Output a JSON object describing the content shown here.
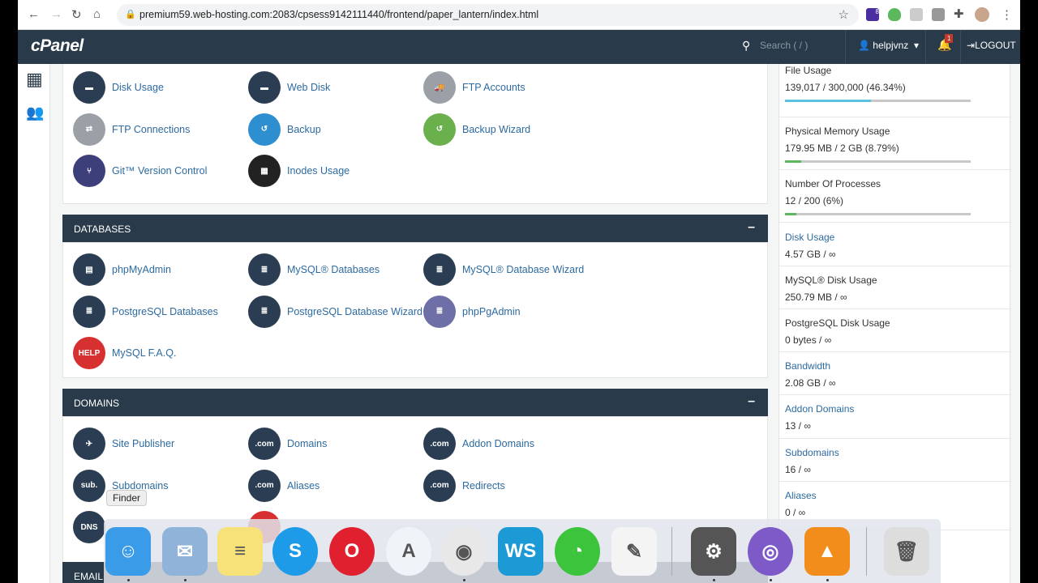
{
  "browser": {
    "url": "premium59.web-hosting.com:2083/cpsess9142111440/frontend/paper_lantern/index.html",
    "extension_badge": "8"
  },
  "header": {
    "logo": "cPanel",
    "search_placeholder": "Search ( / )",
    "user": "helpjvnz",
    "notifications": "1",
    "logout": "LOGOUT"
  },
  "files_items": [
    {
      "label": "Disk Usage",
      "color": "#2b3d52",
      "sub": "#6aa84f",
      "glyph": "▬"
    },
    {
      "label": "Web Disk",
      "color": "#2b3d52",
      "sub": "#3f8f3f",
      "glyph": "▬"
    },
    {
      "label": "FTP Accounts",
      "color": "#9aa0a6",
      "glyph": "🚚"
    },
    {
      "label": "FTP Connections",
      "color": "#9aa0a6",
      "glyph": "⇄"
    },
    {
      "label": "Backup",
      "color": "#2d8fd0",
      "glyph": "↺"
    },
    {
      "label": "Backup Wizard",
      "color": "#6ab04c",
      "sub": "#888",
      "glyph": "↺"
    },
    {
      "label": "Git™ Version Control",
      "color": "#3d3f7a",
      "glyph": "⑂"
    },
    {
      "label": "Inodes Usage",
      "color": "#222",
      "glyph": "▦"
    }
  ],
  "databases": {
    "title": "DATABASES",
    "items": [
      {
        "label": "phpMyAdmin",
        "color": "#2b3d52",
        "glyph": "▤"
      },
      {
        "label": "MySQL® Databases",
        "color": "#2b3d52",
        "glyph": "≣"
      },
      {
        "label": "MySQL® Database Wizard",
        "color": "#2b3d52",
        "sub": "#888",
        "glyph": "≣"
      },
      {
        "label": "PostgreSQL Databases",
        "color": "#2b3d52",
        "glyph": "≣"
      },
      {
        "label": "PostgreSQL Database Wizard",
        "color": "#2b3d52",
        "sub": "#888",
        "glyph": "≣"
      },
      {
        "label": "phpPgAdmin",
        "color": "#6f6fa8",
        "glyph": "≣"
      },
      {
        "label": "MySQL F.A.Q.",
        "color": "#d63031",
        "glyph": "HELP"
      }
    ]
  },
  "domains": {
    "title": "DOMAINS",
    "items": [
      {
        "label": "Site Publisher",
        "color": "#2b3d52",
        "glyph": "✈"
      },
      {
        "label": "Domains",
        "color": "#2b3d52",
        "glyph": ".com"
      },
      {
        "label": "Addon Domains",
        "color": "#2b3d52",
        "sub": "#4caf50",
        "glyph": ".com"
      },
      {
        "label": "Subdomains",
        "color": "#2b3d52",
        "glyph": "sub."
      },
      {
        "label": "Aliases",
        "color": "#2b3d52",
        "sub": "#6f6fa8",
        "glyph": ".com"
      },
      {
        "label": "Redirects",
        "color": "#2b3d52",
        "sub": "#e8552d",
        "glyph": ".com"
      },
      {
        "label": "",
        "color": "#2b3d52",
        "glyph": "DNS"
      },
      {
        "label": "",
        "color": "#d63031",
        "glyph": ""
      }
    ]
  },
  "email": {
    "title": "EMAIL"
  },
  "stats": [
    {
      "label": "File Usage",
      "value": "139,017 / 300,000   (46.34%)",
      "percent": 46.34,
      "bar_color": "#5bc0de",
      "link": false
    },
    {
      "label": "Physical Memory Usage",
      "value": "179.95 MB / 2 GB   (8.79%)",
      "percent": 8.79,
      "bar_color": "#5cb85c",
      "link": false
    },
    {
      "label": "Number Of Processes",
      "value": "12 / 200   (6%)",
      "percent": 6,
      "bar_color": "#5cb85c",
      "link": false
    },
    {
      "label": "Disk Usage",
      "value": "4.57 GB / ∞",
      "link": true
    },
    {
      "label": "MySQL® Disk Usage",
      "value": "250.79 MB / ∞",
      "link": false
    },
    {
      "label": "PostgreSQL Disk Usage",
      "value": "0 bytes / ∞",
      "link": false
    },
    {
      "label": "Bandwidth",
      "value": "2.08 GB / ∞",
      "link": true
    },
    {
      "label": "Addon Domains",
      "value": "13 / ∞",
      "link": true
    },
    {
      "label": "Subdomains",
      "value": "16 / ∞",
      "link": true
    },
    {
      "label": "Aliases",
      "value": "0 / ∞",
      "link": true
    }
  ],
  "dock": {
    "tooltip": "Finder",
    "apps": [
      {
        "name": "Finder",
        "color": "#3a9be8",
        "glyph": "☺",
        "running": true
      },
      {
        "name": "Mail",
        "color": "#8fb3d9",
        "glyph": "✉",
        "running": true
      },
      {
        "name": "Notes",
        "color": "#f7e27a",
        "glyph": "≡",
        "running": false
      },
      {
        "name": "Skype",
        "color": "#1e9be8",
        "glyph": "S",
        "running": false
      },
      {
        "name": "Opera",
        "color": "#e0202e",
        "glyph": "O",
        "running": false
      },
      {
        "name": "Android Studio",
        "color": "#f0f4f8",
        "glyph": "A",
        "running": false
      },
      {
        "name": "Chrome",
        "color": "#e8e8e8",
        "glyph": "◉",
        "running": true
      },
      {
        "name": "WebStorm",
        "color": "#1b9ad6",
        "glyph": "WS",
        "running": false
      },
      {
        "name": "WhatsApp",
        "color": "#3cc43c",
        "glyph": "◔",
        "running": false
      },
      {
        "name": "TextEdit",
        "color": "#f4f4f4",
        "glyph": "✎",
        "running": false
      },
      {
        "name": "System Preferences",
        "color": "#555",
        "glyph": "⚙",
        "running": true
      },
      {
        "name": "BitTorrent",
        "color": "#7d5ac8",
        "glyph": "◎",
        "running": true
      },
      {
        "name": "VLC",
        "color": "#f28c1b",
        "glyph": "▲",
        "running": true
      },
      {
        "name": "Trash",
        "color": "#ddd",
        "glyph": "🗑",
        "running": false
      }
    ]
  }
}
